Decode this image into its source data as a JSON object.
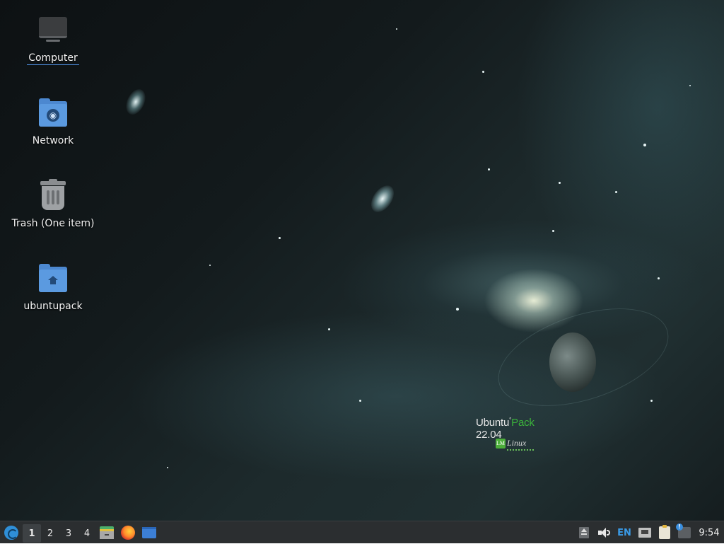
{
  "desktop": {
    "icons": [
      {
        "label": "Computer",
        "icon": "computer-icon"
      },
      {
        "label": "Network",
        "icon": "network-folder-icon"
      },
      {
        "label": "Trash (One item)",
        "icon": "trash-icon"
      },
      {
        "label": "ubuntupack",
        "icon": "home-folder-icon"
      }
    ],
    "wallpaper_brand": {
      "prefix": "Ubuntu",
      "accent": "Pack",
      "version": "22.04",
      "logo_text": "Linux",
      "logo_mark": "LM"
    }
  },
  "taskbar": {
    "workspaces": [
      "1",
      "2",
      "3",
      "4"
    ],
    "active_workspace": "1",
    "launchers": [
      "files-icon",
      "firefox-icon",
      "window-icon"
    ],
    "tray": {
      "language": "EN",
      "clock": "9:54"
    }
  },
  "colors": {
    "accent": "#3a9be8",
    "brand_green": "#3bb33b",
    "panel": "#2b2e30"
  }
}
